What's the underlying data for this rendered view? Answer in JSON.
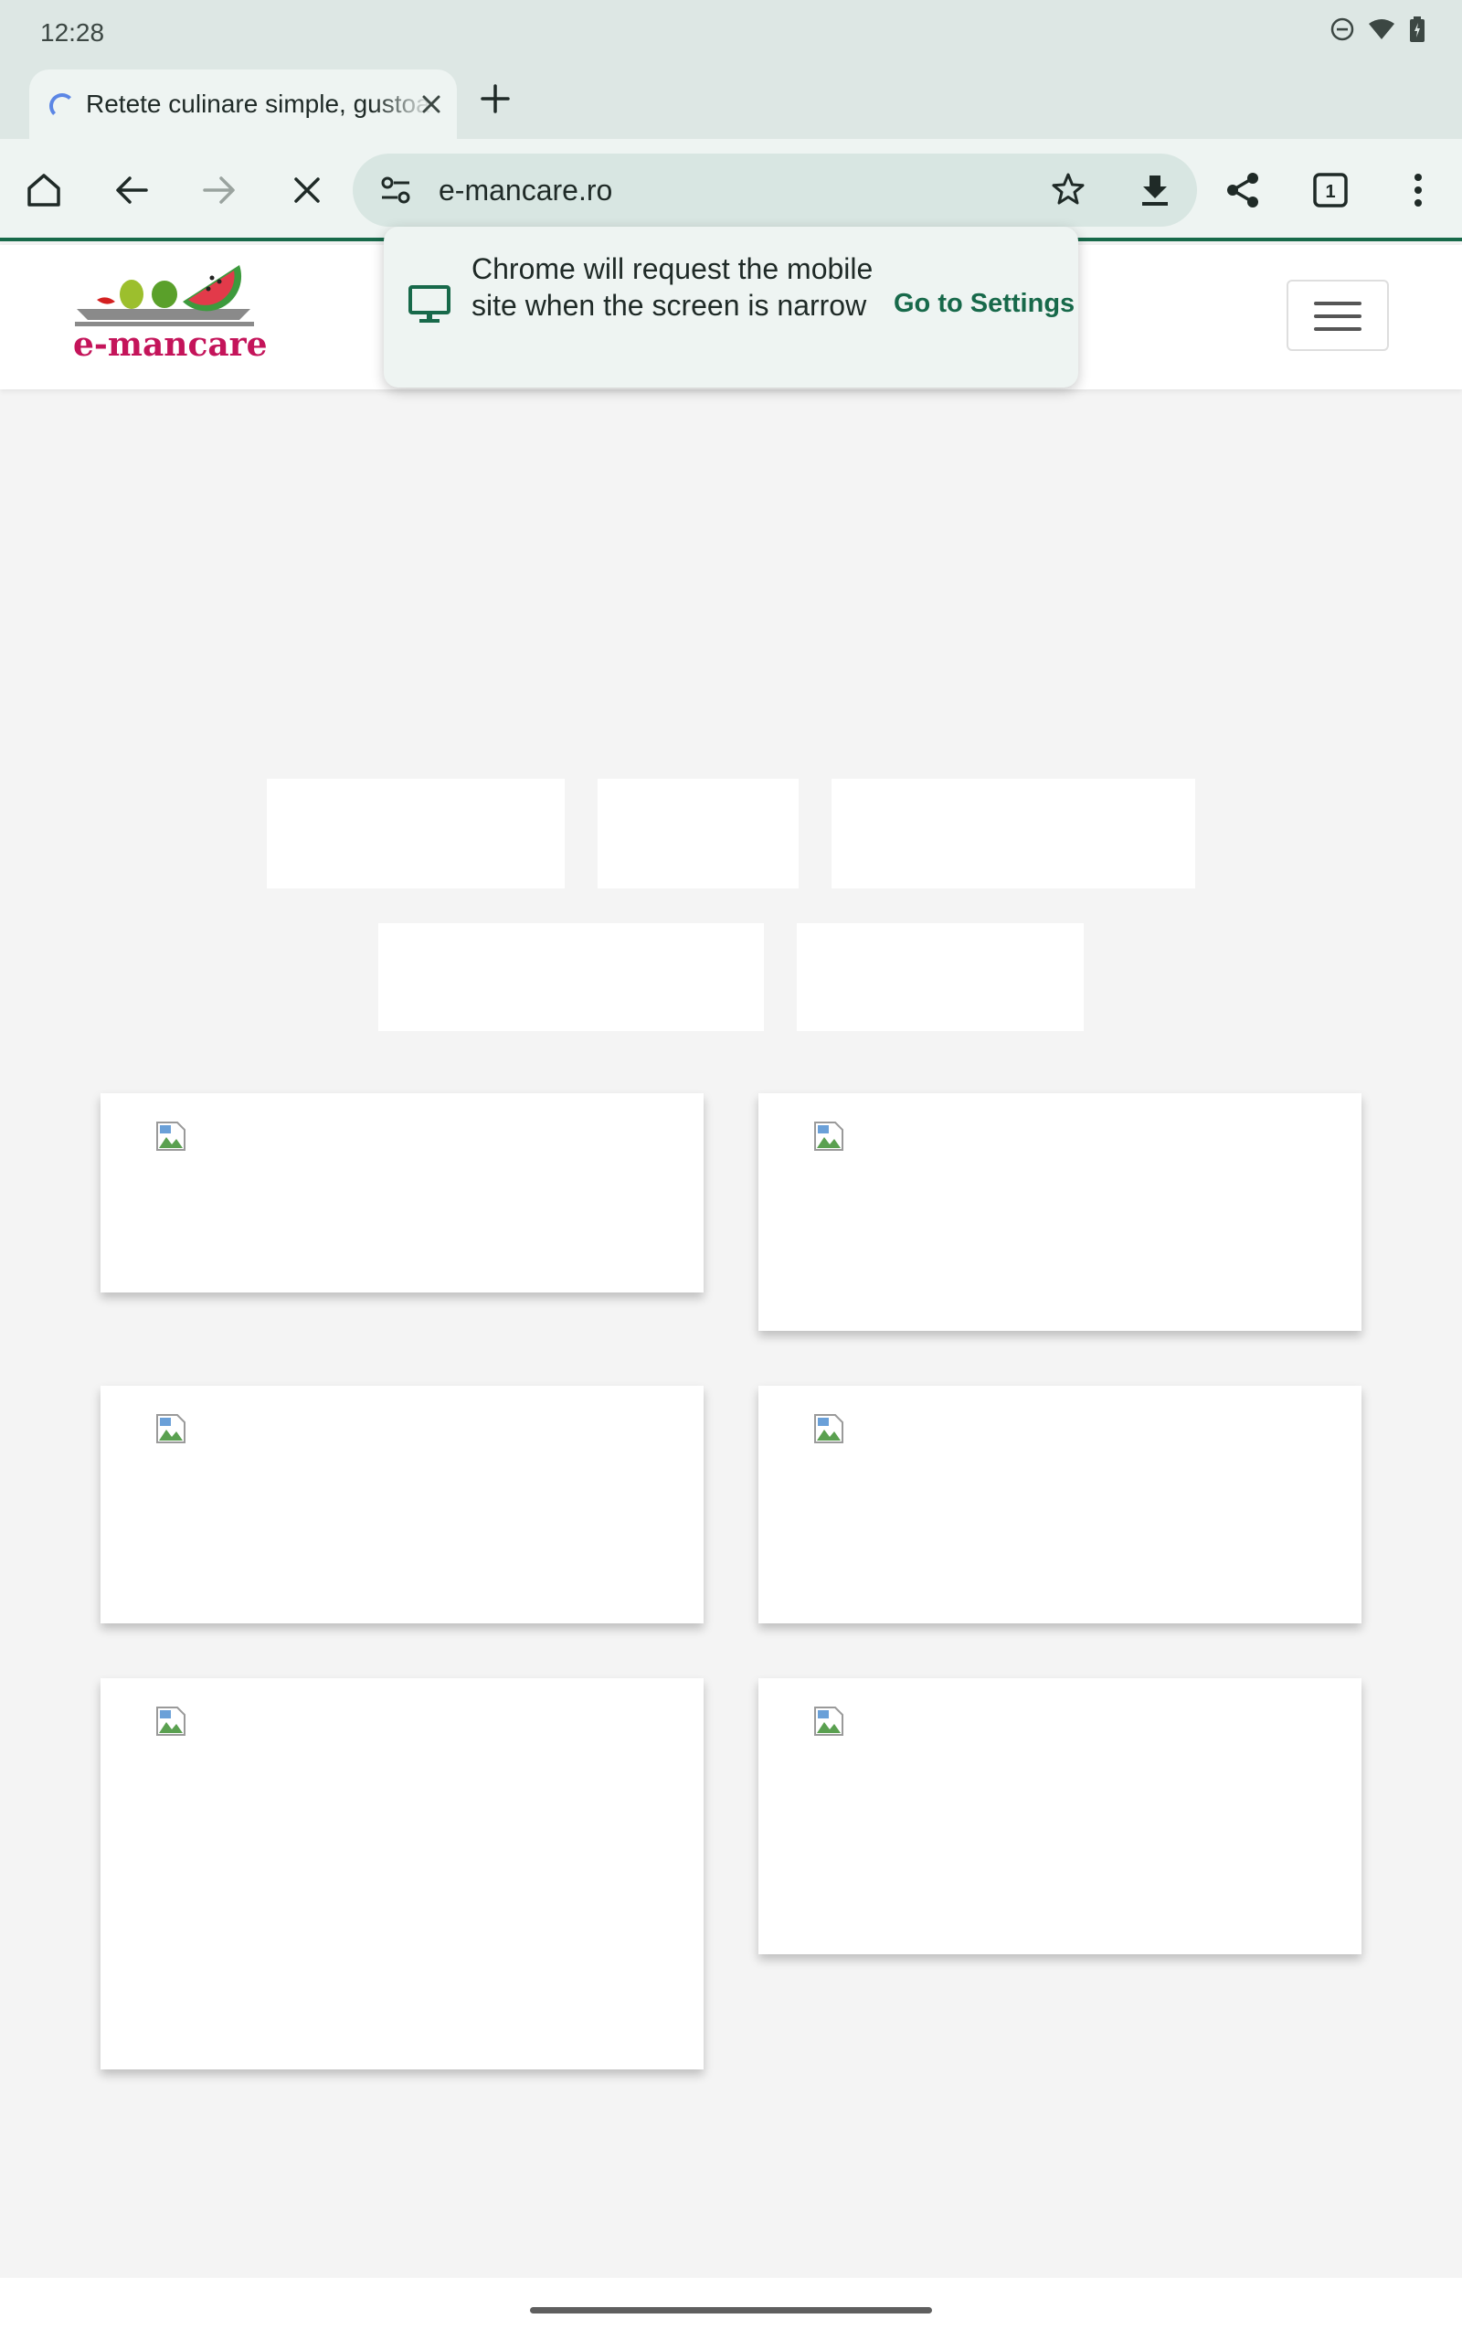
{
  "status_bar": {
    "time": "12:28"
  },
  "tab": {
    "title": "Retete culinare simple, gustoase"
  },
  "toolbar": {
    "url": "e-mancare.ro",
    "tab_count": "1"
  },
  "site": {
    "logo_text": "e-mancare"
  },
  "popup": {
    "message": "Chrome will request the mobile site when the screen is narrow",
    "action": "Go to Settings"
  },
  "colors": {
    "accent": "#17694a",
    "brand": "#c4145a",
    "chrome_bg": "#dde7e4",
    "page_bg": "#f4f4f4"
  }
}
